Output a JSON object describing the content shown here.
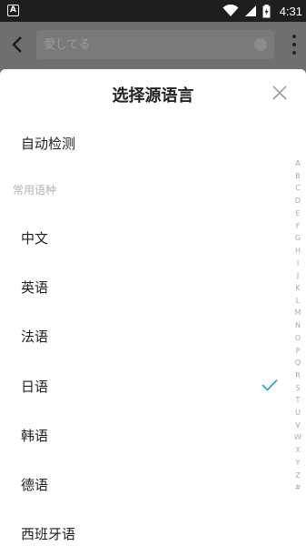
{
  "status_bar": {
    "app_badge": "A",
    "time": "4:31",
    "icons": [
      "wifi-icon",
      "signal-icon",
      "battery-icon"
    ]
  },
  "app_bar": {
    "search_placeholder": "愛してる"
  },
  "sheet": {
    "title": "选择源语言",
    "auto_detect": "自动检测",
    "section_common": "常用语种",
    "languages": [
      {
        "label": "中文",
        "selected": false
      },
      {
        "label": "英语",
        "selected": false
      },
      {
        "label": "法语",
        "selected": false
      },
      {
        "label": "日语",
        "selected": true
      },
      {
        "label": "韩语",
        "selected": false
      },
      {
        "label": "德语",
        "selected": false
      },
      {
        "label": "西班牙语",
        "selected": false
      }
    ]
  },
  "alpha_index": [
    "A",
    "B",
    "C",
    "D",
    "E",
    "F",
    "G",
    "H",
    "I",
    "J",
    "K",
    "L",
    "M",
    "N",
    "O",
    "P",
    "Q",
    "R",
    "S",
    "T",
    "U",
    "V",
    "W",
    "X",
    "Y",
    "Z",
    "#"
  ],
  "colors": {
    "accent": "#2aa6e6",
    "scrim": "#6f6f6f",
    "status_bar": "#1e1e1e"
  }
}
